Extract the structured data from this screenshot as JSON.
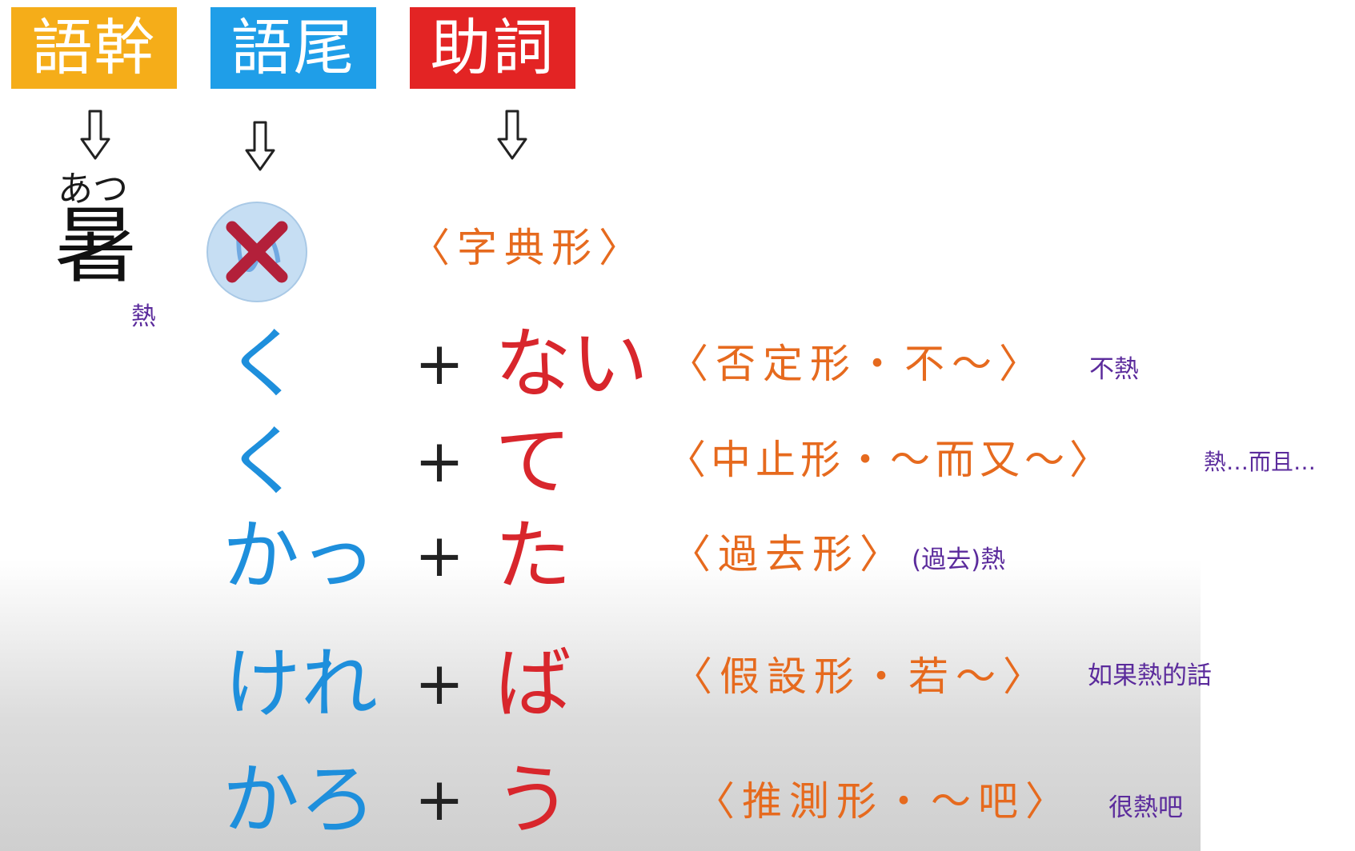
{
  "headers": {
    "stem": "語幹",
    "ending": "語尾",
    "particle": "助詞"
  },
  "stem": {
    "furigana": "あつ",
    "kanji": "暑",
    "meaning": "熱"
  },
  "dictionary_row": {
    "ending": "い",
    "form": "〈字典形〉"
  },
  "rows": [
    {
      "ending": "く",
      "plus": "+",
      "particle": "ない",
      "form": "〈否定形・不～〉",
      "meaning": "不熱"
    },
    {
      "ending": "く",
      "plus": "+",
      "particle": "て",
      "form": "〈中止形・～而又～〉",
      "meaning": "熱…而且…"
    },
    {
      "ending": "かっ",
      "plus": "+",
      "particle": "た",
      "form": "〈過去形〉",
      "meaning": "(過去)熱"
    },
    {
      "ending": "けれ",
      "plus": "+",
      "particle": "ば",
      "form": "〈假設形・若～〉",
      "meaning": "如果熱的話"
    },
    {
      "ending": "かろ",
      "plus": "+",
      "particle": "う",
      "form": "〈推測形・～吧〉",
      "meaning": "很熱吧"
    }
  ],
  "colors": {
    "stem_header": "#f5ad19",
    "ending_header": "#1f9ee8",
    "particle_header": "#e32424",
    "ending_text": "#1e8fdc",
    "particle_text": "#d8262c",
    "form_text": "#e66a1e",
    "meaning_text": "#5b2b9c",
    "cross": "#b3203a"
  },
  "icons": [
    "down-arrow-icon",
    "cross-icon"
  ]
}
